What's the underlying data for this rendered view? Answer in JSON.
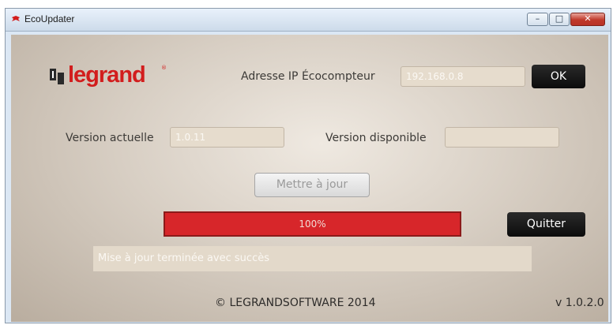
{
  "window": {
    "title": "EcoUpdater",
    "minimize_glyph": "–",
    "maximize_glyph": "□",
    "close_glyph": "✕"
  },
  "logo": {
    "text": "legrand",
    "reg_mark": "®",
    "color": "#d21d1d"
  },
  "ip": {
    "label": "Adresse IP Écocompteur",
    "value": "192.168.0.8",
    "ok_label": "OK"
  },
  "versions": {
    "current_label": "Version actuelle",
    "current_value": "1.0.11",
    "available_label": "Version disponible",
    "available_value": ""
  },
  "update_button": "Mettre à jour",
  "progress": {
    "percent": 100,
    "text": "100%",
    "color": "#d7262a"
  },
  "quit_button": "Quitter",
  "status_text": "Mise à jour terminée avec succès",
  "footer": {
    "copyright": "© LEGRANDSOFTWARE 2014",
    "version": "v 1.0.2.0"
  }
}
